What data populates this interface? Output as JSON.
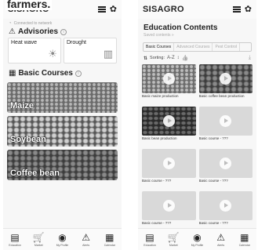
{
  "overlay": {
    "text": "farmers."
  },
  "left": {
    "header": {
      "title": "SISAGRO"
    },
    "connection": {
      "text": "Connected to network"
    },
    "advisories": {
      "title": "Advisories",
      "items": [
        {
          "label": "Heat wave",
          "icon": "thermometer-sun-icon"
        },
        {
          "label": "Drought",
          "icon": "drought-icon"
        }
      ]
    },
    "courses": {
      "title": "Basic Courses",
      "items": [
        {
          "label": "Maize"
        },
        {
          "label": "Soybean"
        },
        {
          "label": "Coffee bean"
        }
      ]
    }
  },
  "right": {
    "header": {
      "title": "SISAGRO"
    },
    "education": {
      "title": "Education Contents",
      "saved_link": "Saved contents »"
    },
    "tabs": [
      "Basic Courses",
      "Advanced Courses",
      "Pest Control"
    ],
    "sorting": {
      "label": "Sorting:",
      "order": "A-Z"
    },
    "videos": [
      {
        "caption": "Basic maize production",
        "thumb": "maize"
      },
      {
        "caption": "Basic coffee bean production",
        "thumb": "coffee"
      },
      {
        "caption": "Basic bean production",
        "thumb": "bean"
      },
      {
        "caption": "Basic course - ???",
        "thumb": "placeholder"
      },
      {
        "caption": "Basic course - ???",
        "thumb": "placeholder"
      },
      {
        "caption": "Basic course - ???",
        "thumb": "placeholder"
      },
      {
        "caption": "Basic course - ???",
        "thumb": "placeholder"
      },
      {
        "caption": "Basic course - ???",
        "thumb": "placeholder"
      }
    ]
  },
  "nav": {
    "items": [
      {
        "label": "Education",
        "icon": "education-icon"
      },
      {
        "label": "Market",
        "icon": "cart-icon"
      },
      {
        "label": "My Profile",
        "icon": "profile-icon"
      },
      {
        "label": "Alerts",
        "icon": "alert-icon"
      },
      {
        "label": "Calendar",
        "icon": "calendar-icon"
      }
    ]
  }
}
